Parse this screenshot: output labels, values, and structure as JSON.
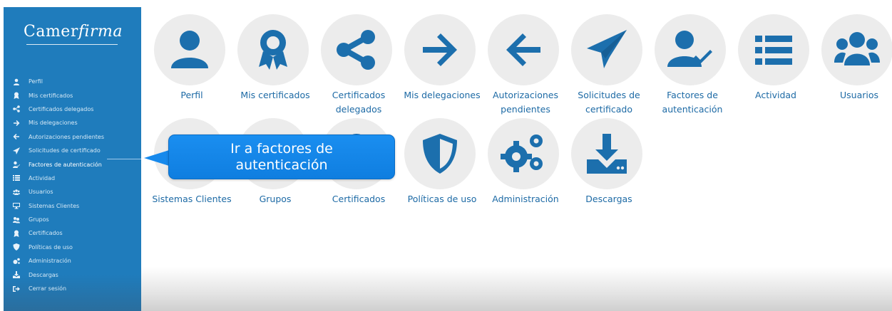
{
  "brand": {
    "prefix": "Camer",
    "suffix": "firma"
  },
  "sidebar": {
    "items": [
      {
        "label": "Perfil",
        "icon": "user-icon"
      },
      {
        "label": "Mis certificados",
        "icon": "award-icon"
      },
      {
        "label": "Certificados delegados",
        "icon": "share-icon"
      },
      {
        "label": "Mis delegaciones",
        "icon": "arrow-right-icon"
      },
      {
        "label": "Autorizaciones pendientes",
        "icon": "arrow-left-icon"
      },
      {
        "label": "Solicitudes de certificado",
        "icon": "paper-plane-icon"
      },
      {
        "label": "Factores de autenticación",
        "icon": "user-check-icon"
      },
      {
        "label": "Actividad",
        "icon": "list-icon"
      },
      {
        "label": "Usuarios",
        "icon": "users-icon"
      },
      {
        "label": "Sistemas Clientes",
        "icon": "desktop-icon"
      },
      {
        "label": "Grupos",
        "icon": "group-icon"
      },
      {
        "label": "Certificados",
        "icon": "award-icon"
      },
      {
        "label": "Políticas de uso",
        "icon": "shield-icon"
      },
      {
        "label": "Administración",
        "icon": "gears-icon"
      },
      {
        "label": "Descargas",
        "icon": "download-icon"
      },
      {
        "label": "Cerrar sesión",
        "icon": "sign-out-icon"
      }
    ]
  },
  "tiles": {
    "perfil": {
      "label": "Perfil",
      "icon": "user-icon"
    },
    "mis_certificados": {
      "label": "Mis certificados",
      "icon": "award-icon"
    },
    "certificados_delegados": {
      "line1": "Certificados",
      "line2": "delegados",
      "icon": "share-icon"
    },
    "mis_delegaciones": {
      "label": "Mis delegaciones",
      "icon": "arrow-right-icon"
    },
    "autorizaciones_pendientes": {
      "line1": "Autorizaciones",
      "line2": "pendientes",
      "icon": "arrow-left-icon"
    },
    "solicitudes_certificado": {
      "line1": "Solicitudes de",
      "line2": "certificado",
      "icon": "paper-plane-icon"
    },
    "factores_autenticacion": {
      "line1": "Factores de",
      "line2": "autenticación",
      "icon": "user-check-icon"
    },
    "actividad": {
      "label": "Actividad",
      "icon": "list-icon"
    },
    "usuarios": {
      "label": "Usuarios",
      "icon": "users-icon"
    },
    "sistemas_clientes": {
      "label": "Sistemas Clientes",
      "icon": "desktop-icon"
    },
    "grupos": {
      "label": "Grupos",
      "icon": "group-icon"
    },
    "certificados": {
      "label": "Certificados",
      "icon": "award-icon"
    },
    "politicas_uso": {
      "label": "Políticas de uso",
      "icon": "shield-icon"
    },
    "administracion": {
      "label": "Administración",
      "icon": "gears-icon"
    },
    "descargas": {
      "label": "Descargas",
      "icon": "download-icon"
    }
  },
  "tooltip": {
    "line1": "Ir a factores de",
    "line2": "autenticación"
  },
  "colors": {
    "sidebar": "#1f7cbc",
    "accent": "#1c6fad",
    "tile_bg": "#ececec",
    "tooltip": "#1689ec"
  }
}
